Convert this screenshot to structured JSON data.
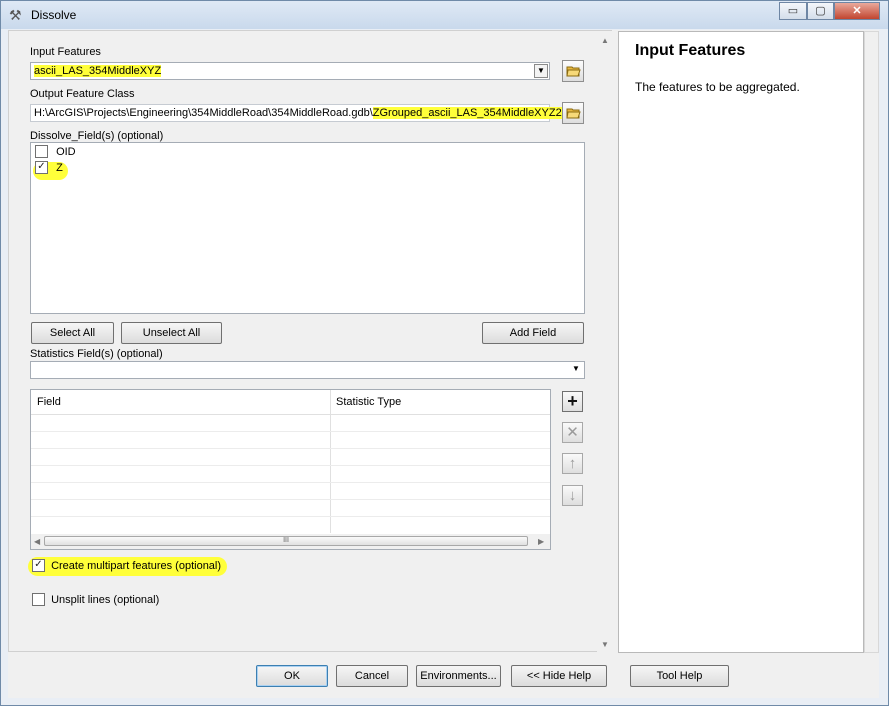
{
  "window": {
    "title": "Dissolve",
    "app_icon": "hammer-icon",
    "controls": {
      "minimize": "▭",
      "maximize": "▢",
      "close": "✕"
    }
  },
  "form": {
    "input_features": {
      "label": "Input Features",
      "value": "ascii_LAS_354MiddleXYZ"
    },
    "output_feature_class": {
      "label": "Output Feature Class",
      "value_prefix": "H:\\ArcGIS\\Projects\\Engineering\\354MiddleRoad\\354MiddleRoad.gdb\\",
      "value_highlighted": "ZGrouped_ascii_LAS_354MiddleXYZ2"
    },
    "dissolve_fields": {
      "label": "Dissolve_Field(s) (optional)",
      "items": [
        {
          "label": "OID",
          "checked": false
        },
        {
          "label": "Z",
          "checked": true
        }
      ]
    },
    "buttons": {
      "select_all": "Select All",
      "unselect_all": "Unselect All",
      "add_field": "Add Field"
    },
    "statistics_fields": {
      "label": "Statistics Field(s) (optional)",
      "value": "",
      "columns": [
        "Field",
        "Statistic Type"
      ],
      "scroll_grip": "III"
    },
    "side_buttons": {
      "add": "+",
      "remove": "✕",
      "up": "↑",
      "down": "↓"
    },
    "multipart": {
      "label": "Create multipart features (optional)",
      "checked": true
    },
    "unsplit": {
      "label": "Unsplit lines (optional)",
      "checked": false
    }
  },
  "help": {
    "title": "Input Features",
    "body": "The features to be aggregated."
  },
  "footer": {
    "ok": "OK",
    "cancel": "Cancel",
    "environments": "Environments...",
    "hide_help": "<< Hide Help",
    "tool_help": "Tool Help"
  },
  "colors": {
    "highlight": "#ffff3a",
    "titlebar": "#c9d9ec",
    "face": "#f0f0f0"
  }
}
